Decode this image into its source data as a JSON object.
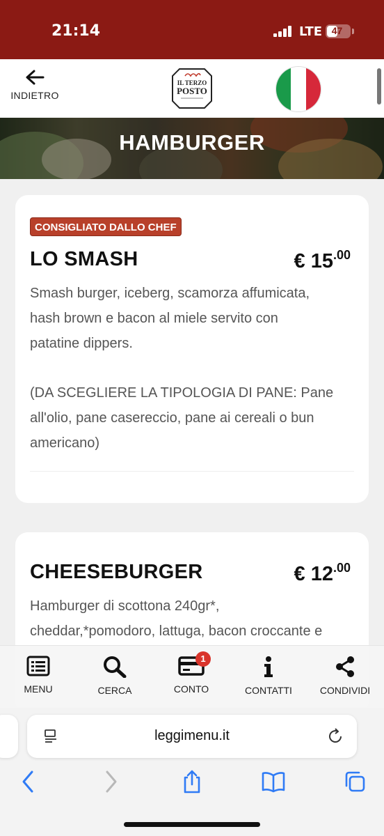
{
  "status_bar": {
    "time": "21:14",
    "network": "LTE",
    "battery": "47",
    "battery_level": 0.47
  },
  "header": {
    "back_label": "INDIETRO",
    "logo_line1": "IL TERZO",
    "logo_line2": "POSTO"
  },
  "banner": {
    "title": "HAMBURGER"
  },
  "items": [
    {
      "badge": "CONSIGLIATO DALLO CHEF",
      "name": "LO SMASH",
      "price_main": "€ 15",
      "price_cents": ".00",
      "description_lines": [
        "Smash burger, iceberg, scamorza affumicata,",
        "hash brown e bacon al miele servito con",
        "patatine dippers."
      ],
      "note_lines": [
        "(DA SCEGLIERE LA TIPOLOGIA DI PANE: Pane",
        "all'olio, pane casereccio, pane ai cereali o bun",
        "americano)"
      ]
    },
    {
      "name": "CHEESEBURGER",
      "price_main": "€ 12",
      "price_cents": ".00",
      "description_lines": [
        "Hamburger di scottona 240gr*,",
        "cheddar,*pomodoro, lattuga, bacon croccante e"
      ]
    }
  ],
  "toolbar": {
    "menu": "MENU",
    "search": "CERCA",
    "bill": "CONTO",
    "bill_count": "1",
    "contacts": "CONTATTI",
    "share": "CONDIVIDI"
  },
  "browser": {
    "url": "leggimenu.it"
  },
  "colors": {
    "brand": "#8b1a14",
    "badge": "#b8402a",
    "notification": "#d9342b",
    "safari_blue": "#2f7bf5"
  }
}
